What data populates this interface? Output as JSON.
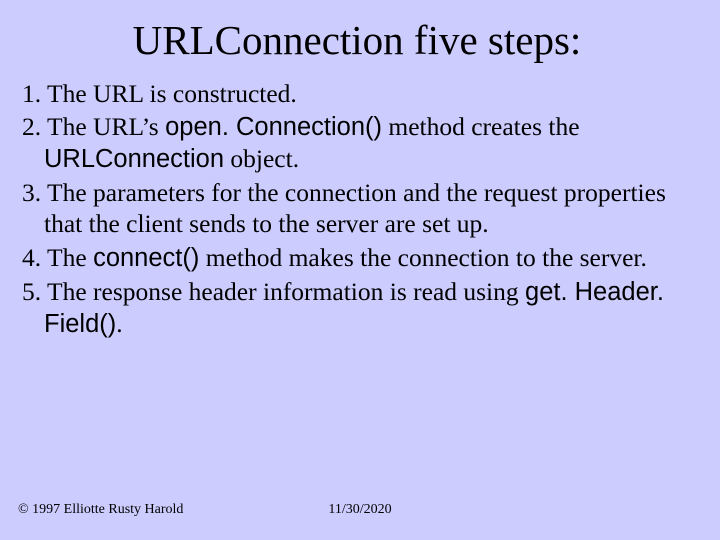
{
  "title": "URLConnection five steps:",
  "steps": {
    "s1": "1. The URL is constructed.",
    "s2a": "2. The URL’s ",
    "s2b": "open. Connection()",
    "s2c": " method creates the ",
    "s2d": "URLConnection",
    "s2e": " object.",
    "s3": "3. The parameters for the connection and the request properties that the client sends to the server are set up.",
    "s4a": "4. The ",
    "s4b": "connect()",
    "s4c": " method makes the connection to the server.",
    "s5a": "5. The response header information is read using ",
    "s5b": "get. Header. Field()",
    "s5c": "."
  },
  "footer": {
    "copyright": "© 1997 Elliotte Rusty Harold",
    "date": "11/30/2020"
  }
}
